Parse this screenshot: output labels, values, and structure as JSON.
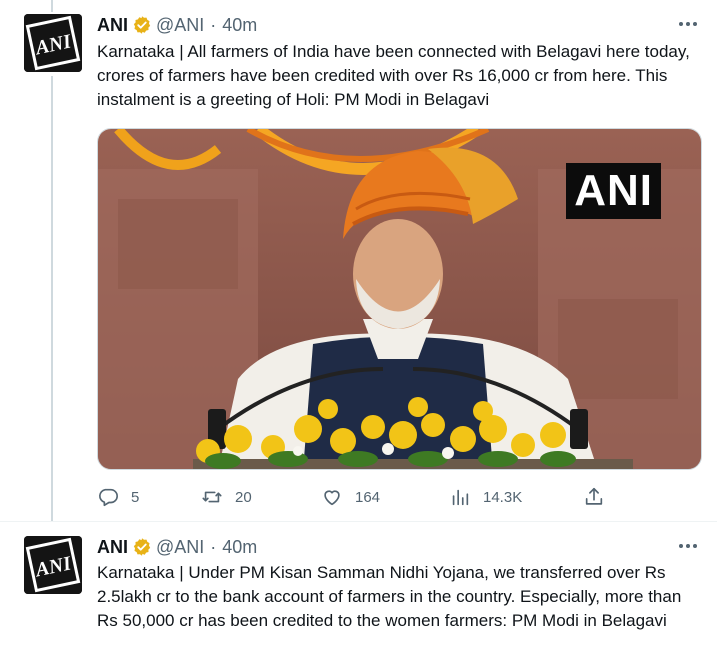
{
  "tweets": [
    {
      "author": {
        "name": "ANI",
        "handle": "@ANI",
        "time": "40m",
        "avatar_text": "ANI"
      },
      "text": "Karnataka | All farmers of India have been connected with Belagavi here today, crores of farmers have been credited with over Rs 16,000 cr from here. This instalment is a greeting of Holi: PM Modi in Belagavi",
      "media": {
        "watermark": "ANI"
      },
      "stats": {
        "replies": "5",
        "retweets": "20",
        "likes": "164",
        "views": "14.3K"
      }
    },
    {
      "author": {
        "name": "ANI",
        "handle": "@ANI",
        "time": "40m",
        "avatar_text": "ANI"
      },
      "text": "Karnataka | Under PM Kisan Samman Nidhi Yojana, we transferred over Rs 2.5lakh cr to the bank account of farmers in the country. Especially, more than Rs 50,000 cr has been credited to the women farmers: PM Modi in Belagavi"
    }
  ],
  "icons": {
    "reply": "reply-icon",
    "retweet": "retweet-icon",
    "like": "heart-icon",
    "views": "views-icon",
    "share": "share-icon",
    "verified": "verified-badge-icon",
    "more": "more-options-icon"
  },
  "colors": {
    "verified_gold": "#e8b217",
    "muted_text": "#536471",
    "primary_text": "#0f1419",
    "thread_line": "#cfd9de"
  }
}
